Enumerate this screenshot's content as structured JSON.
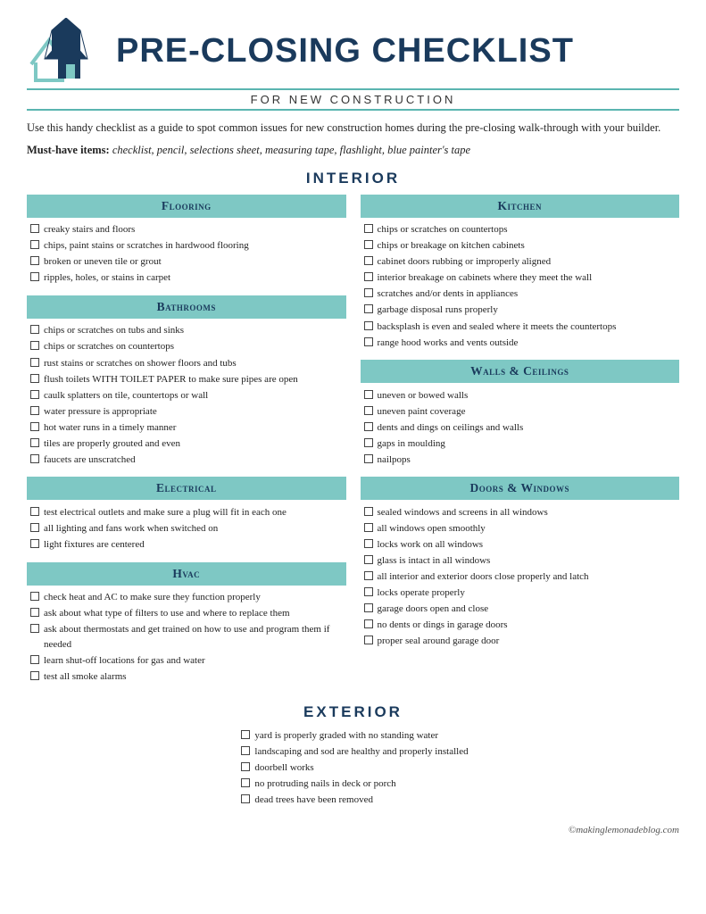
{
  "header": {
    "title": "Pre-Closing Checklist",
    "subtitle": "FOR NEW CONSTRUCTION"
  },
  "intro": "Use this handy checklist as a guide to spot common issues for new construction homes during the pre-closing walk-through with your builder.",
  "must_have": {
    "label": "Must-have items:",
    "items": "checklist, pencil, selections sheet, measuring tape, flashlight, blue painter's tape"
  },
  "interior_label": "INTERIOR",
  "exterior_label": "EXTERIOR",
  "categories": {
    "flooring": {
      "header": "Flooring",
      "items": [
        "creaky stairs and floors",
        "chips, paint stains or scratches in hardwood flooring",
        "broken or uneven tile or grout",
        "ripples, holes, or stains in carpet"
      ]
    },
    "bathrooms": {
      "header": "Bathrooms",
      "items": [
        "chips or scratches on tubs and sinks",
        "chips or scratches on countertops",
        "rust stains or scratches on shower floors and tubs",
        "flush toilets WITH TOILET PAPER to make sure pipes are open",
        "caulk splatters on tile, countertops or wall",
        "water pressure is appropriate",
        "hot water runs in a timely manner",
        "tiles are properly grouted and even",
        "faucets are unscratched"
      ]
    },
    "electrical": {
      "header": "Electrical",
      "items": [
        "test electrical outlets and make sure a plug will fit in each one",
        "all lighting and fans work when switched on",
        "light fixtures are centered"
      ]
    },
    "hvac": {
      "header": "Hvac",
      "items": [
        "check heat and AC to make sure they function properly",
        "ask about what type of filters to use and where to replace them",
        "ask about thermostats and get trained on how to use and program them if needed",
        "learn shut-off locations for gas and water",
        "test all smoke alarms"
      ]
    },
    "kitchen": {
      "header": "Kitchen",
      "items": [
        "chips or scratches on countertops",
        "chips or breakage on kitchen cabinets",
        "cabinet doors rubbing or improperly aligned",
        "interior breakage on cabinets where they meet the wall",
        "scratches and/or dents in appliances",
        "garbage disposal runs properly",
        "backsplash is even and sealed where it meets the countertops",
        "range hood works and vents outside"
      ]
    },
    "walls_ceilings": {
      "header": "Walls & Ceilings",
      "items": [
        "uneven or bowed walls",
        "uneven paint coverage",
        "dents and dings on ceilings and walls",
        "gaps in moulding",
        "nailpops"
      ]
    },
    "doors_windows": {
      "header": "Doors & Windows",
      "items": [
        "sealed windows and screens in all windows",
        "all windows open smoothly",
        "locks work on all windows",
        "glass is intact in all windows",
        "all interior and exterior doors close properly and latch",
        "locks operate properly",
        "garage doors open and close",
        "no dents or dings in garage doors",
        "proper seal around garage door"
      ]
    },
    "exterior": {
      "header": "EXTERIOR",
      "items": [
        "yard is properly graded with no standing water",
        "landscaping and sod are healthy and properly installed",
        "doorbell works",
        "no protruding nails in deck or porch",
        "dead trees have been removed"
      ]
    }
  },
  "copyright": "©makinglemonadeblog.com"
}
